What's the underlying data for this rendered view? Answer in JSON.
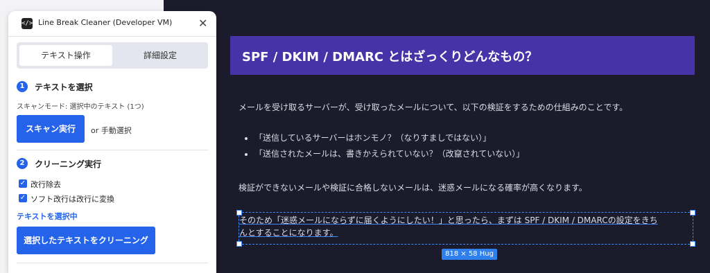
{
  "panel": {
    "title": "Line Break Cleaner (Developer VM)",
    "app_icon": "code-icon",
    "close_glyph": "✕",
    "tabs": [
      {
        "label": "テキスト操作",
        "active": true
      },
      {
        "label": "詳細設定",
        "active": false
      }
    ],
    "step1": {
      "number": "1",
      "title": "テキストを選択",
      "mode_text": "スキャンモード: 選択中のテキスト (1つ)",
      "scan_button": "スキャン実行",
      "or_text": "or 手動選択"
    },
    "step2": {
      "number": "2",
      "title": "クリーニング実行",
      "options": [
        {
          "label": "改行除去",
          "checked": true
        },
        {
          "label": "ソフト改行は改行に変換",
          "checked": true
        }
      ],
      "status_text": "テキストを選択中",
      "clean_button": "選択したテキストをクリーニング"
    }
  },
  "canvas": {
    "heading": "SPF / DKIM / DMARC とはざっくりどんなもの？",
    "intro": "メールを受け取るサーバーが、受け取ったメールについて、以下の検証をするための仕組みのことです。",
    "bullets": [
      "「送信しているサーバーはホンモノ？（なりすましではない）」",
      "「送信されたメールは、書きかえられていない？（改竄されていない）」"
    ],
    "warning": "検証ができないメールや検証に合格しないメールは、迷惑メールになる確率が高くなります。",
    "selected_line1": "そのため「迷惑メールにならずに届くようにしたい！」と思ったら、まずは SPF / DKIM / DMARCの設定をきち",
    "selected_line2": "んとすることになります。",
    "size_badge": "818 × 58 Hug"
  },
  "colors": {
    "accent": "#2563eb",
    "heading_bg": "#4633a8",
    "canvas_bg": "#1b1b2b",
    "selection": "#3b8cff"
  }
}
